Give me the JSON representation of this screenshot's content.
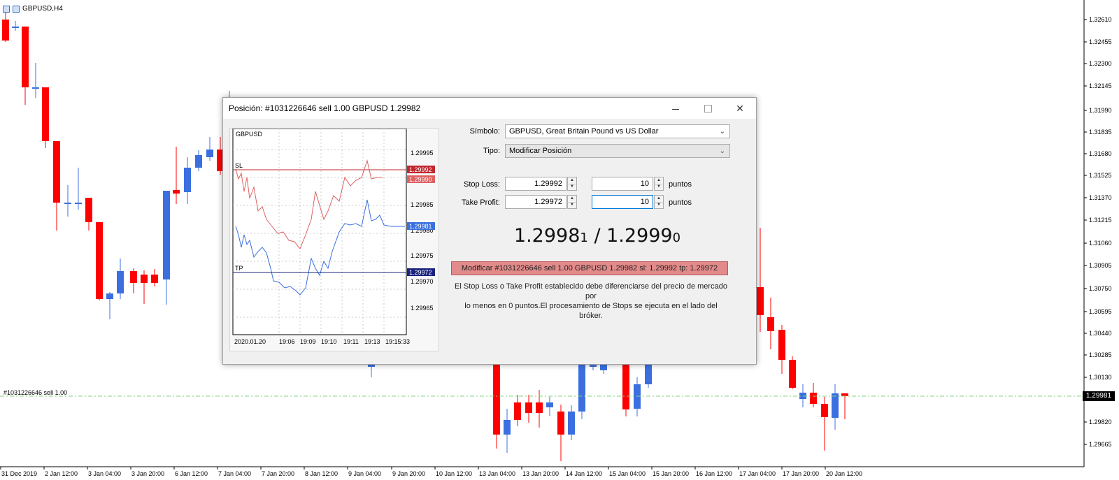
{
  "chart": {
    "symbol_title": "GBPUSD,H4",
    "current_price": "1.29981",
    "order_label": "#1031226646 sell 1.00",
    "price_axis": [
      "1.32610",
      "1.32455",
      "1.32300",
      "1.32145",
      "1.31990",
      "1.31835",
      "1.31680",
      "1.31525",
      "1.31370",
      "1.31215",
      "1.31060",
      "1.30905",
      "1.30750",
      "1.30595",
      "1.30440",
      "1.30285",
      "1.30130",
      "1.29820",
      "1.29665"
    ],
    "time_axis": [
      "31 Dec 2019",
      "2 Jan 12:00",
      "3 Jan 04:00",
      "3 Jan 20:00",
      "6 Jan 12:00",
      "7 Jan 04:00",
      "7 Jan 20:00",
      "8 Jan 12:00",
      "9 Jan 04:00",
      "9 Jan 20:00",
      "10 Jan 12:00",
      "13 Jan 04:00",
      "13 Jan 20:00",
      "14 Jan 12:00",
      "15 Jan 04:00",
      "15 Jan 20:00",
      "16 Jan 12:00",
      "17 Jan 04:00",
      "17 Jan 20:00",
      "20 Jan 12:00"
    ],
    "colors": {
      "bull": "#3b6fe0",
      "bear": "#ff0000",
      "order_line": "#7cd67c",
      "axis": "#000000"
    }
  },
  "dialog": {
    "title": "Posición: #1031226646 sell 1.00 GBPUSD 1.29982",
    "mini_chart": {
      "symbol": "GBPUSD",
      "sl_label": "SL",
      "tp_label": "TP",
      "price_labels": [
        "1.29995",
        "1.29985",
        "1.29980",
        "1.29975",
        "1.29970",
        "1.29965"
      ],
      "sl_tag": "1.29992",
      "bid_tag": "1.29990",
      "ask_tag": "1.29981",
      "tp_tag": "1.29972",
      "time_labels": [
        "2020.01.20",
        "19:06",
        "19:09",
        "19:10",
        "19:11",
        "19:13",
        "19:15:33"
      ],
      "colors": {
        "sl": "#c0272d",
        "tp": "#1a237e",
        "ask_line": "#3b6fe0",
        "bid_line": "#e06060"
      }
    },
    "symbol_label": "Símbolo:",
    "symbol_value": "GBPUSD, Great Britain Pound vs US Dollar",
    "type_label": "Tipo:",
    "type_value": "Modificar Posición",
    "stop_loss_label": "Stop Loss:",
    "stop_loss_value": "1.29992",
    "stop_loss_points": "10",
    "take_profit_label": "Take Profit:",
    "take_profit_value": "1.29972",
    "take_profit_points": "10",
    "points_unit": "puntos",
    "quote_bid_main": "1.2998",
    "quote_bid_small": "1",
    "quote_sep": " / ",
    "quote_ask_main": "1.2999",
    "quote_ask_small": "0",
    "modify_button": "Modificar #1031226646 sell 1.00 GBPUSD 1.29982 sl: 1.29992 tp: 1.29972",
    "info_line1": "El Stop Loss o Take Profit establecido debe diferenciarse del precio de mercado por",
    "info_line2": "lo menos en 0 puntos.El procesamiento de Stops se ejecuta en el lado del bróker."
  }
}
